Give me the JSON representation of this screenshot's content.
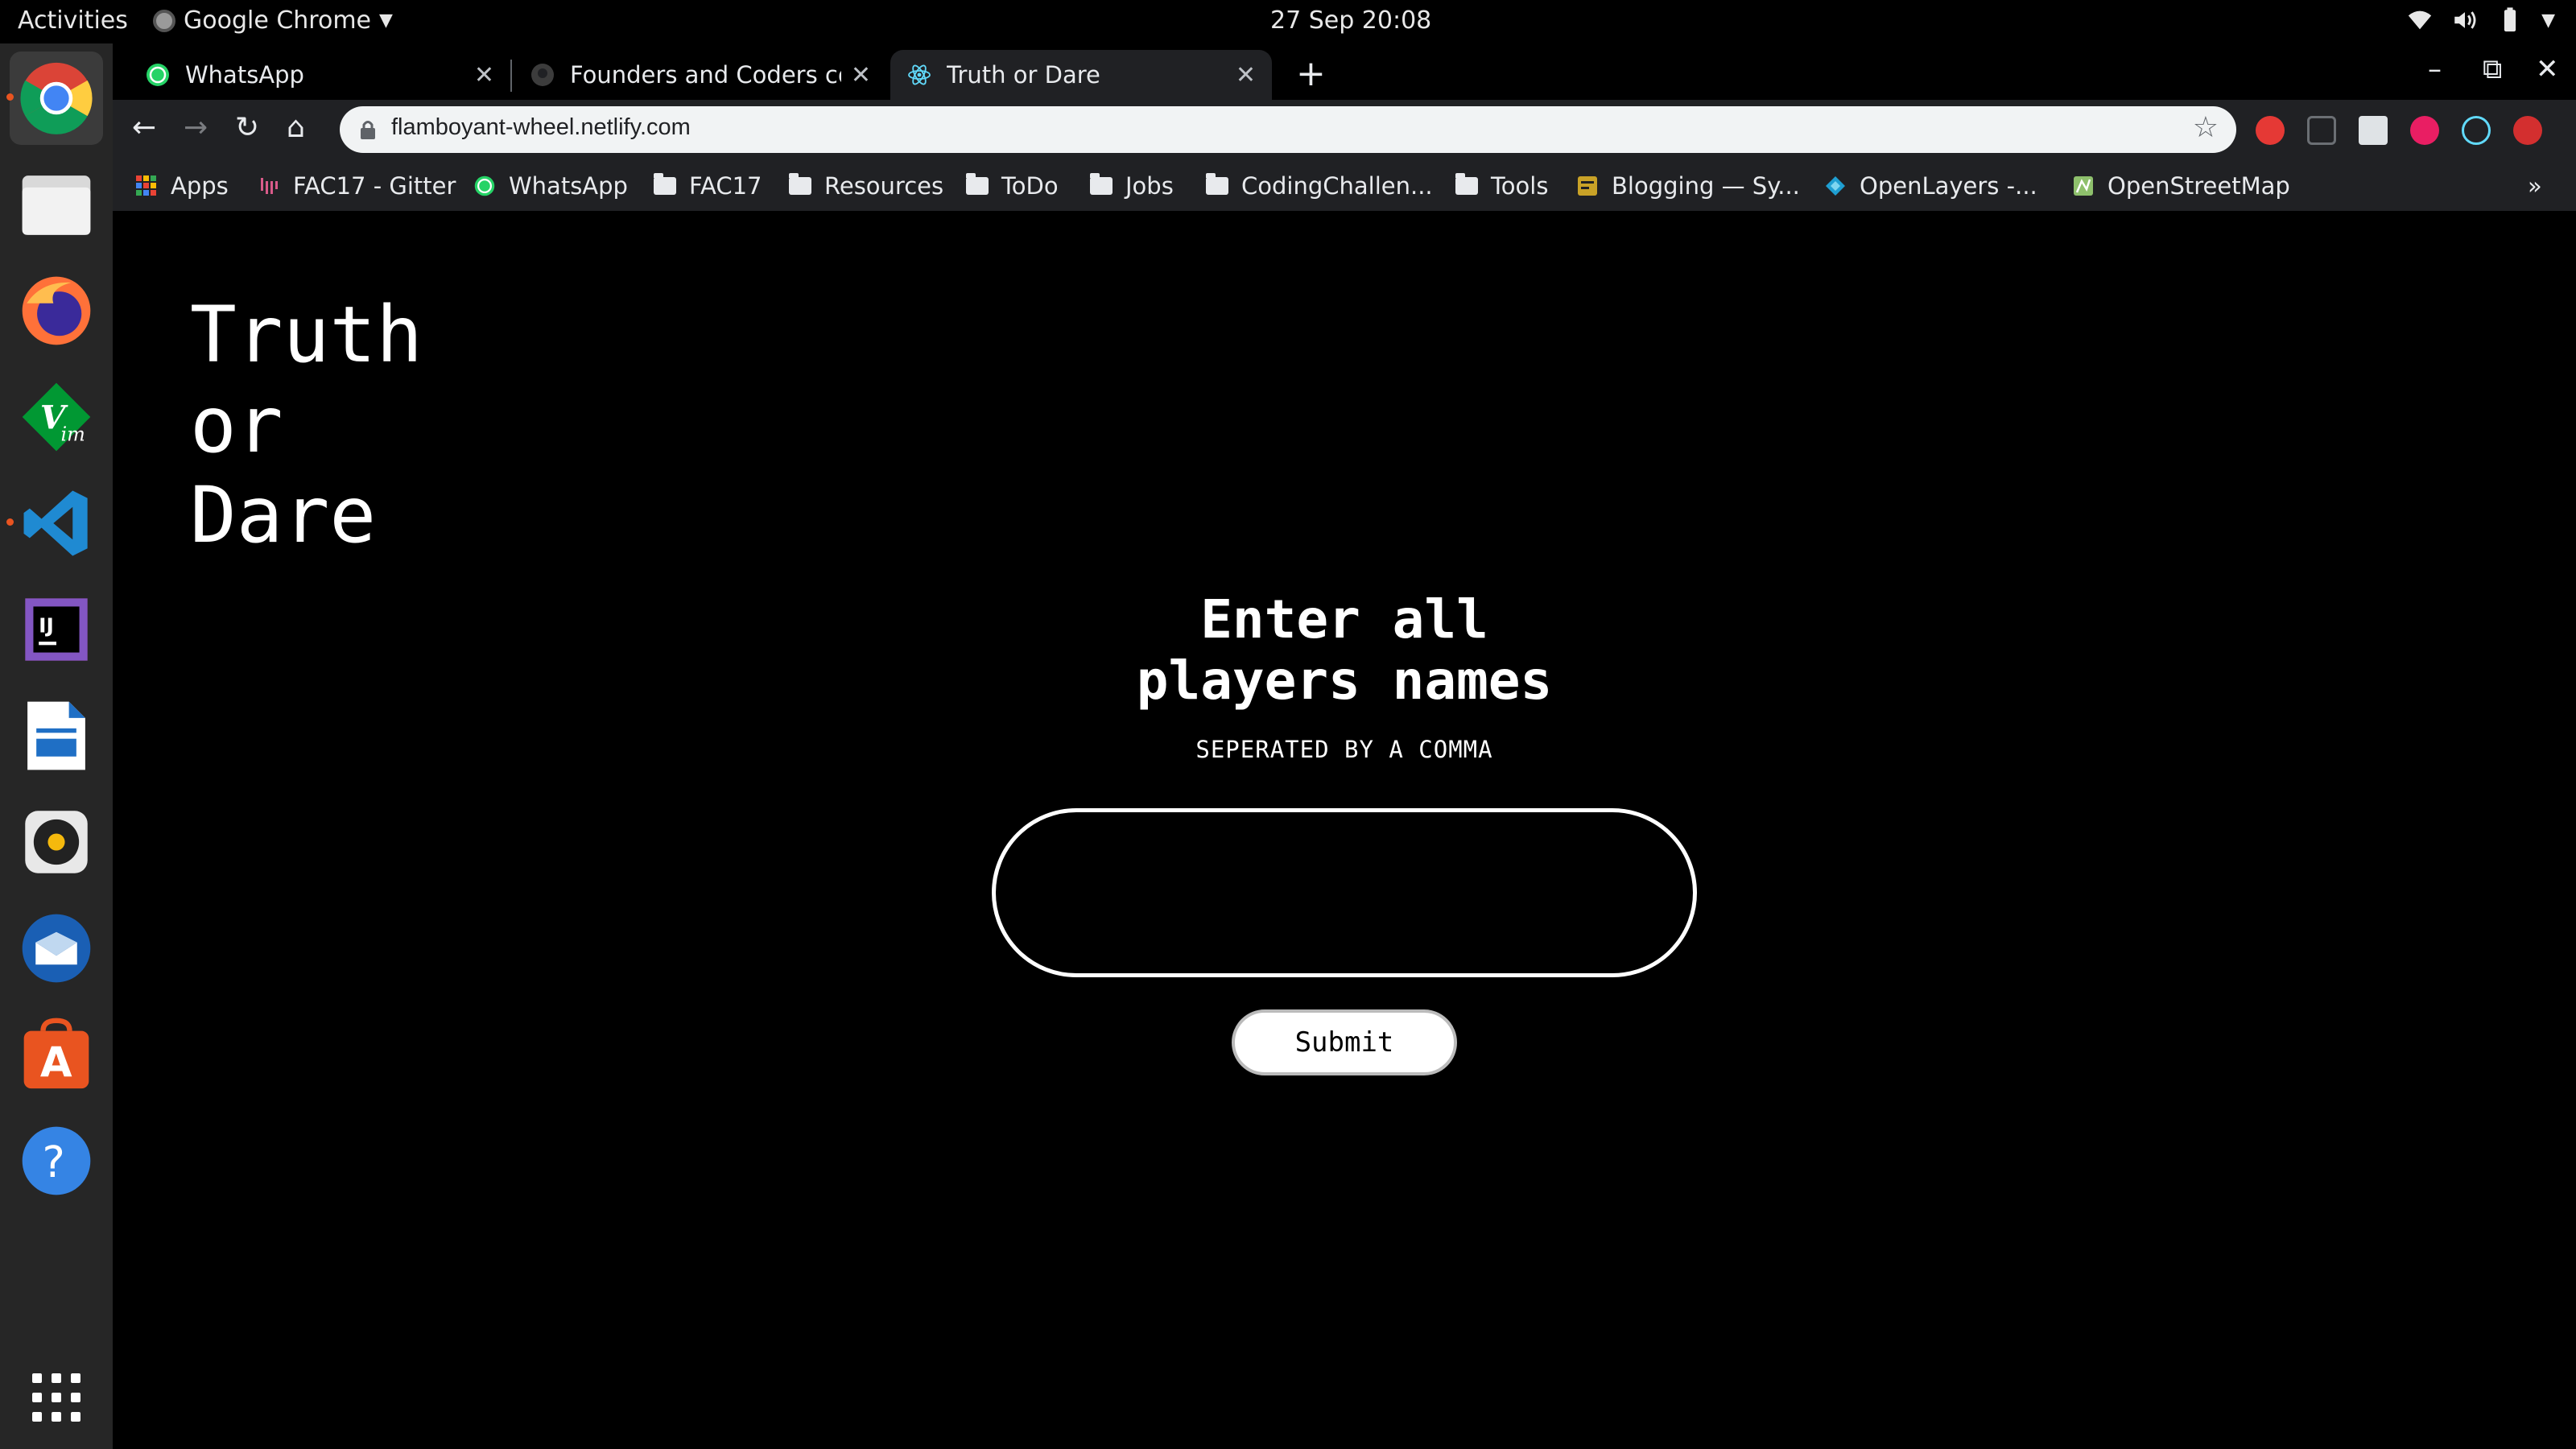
{
  "system_bar": {
    "activities": "Activities",
    "app_name": "Google Chrome",
    "clock": "27 Sep  20:08"
  },
  "dock": {
    "apps": [
      {
        "name": "chrome-icon"
      },
      {
        "name": "files-icon"
      },
      {
        "name": "firefox-icon"
      },
      {
        "name": "vim-icon"
      },
      {
        "name": "vscode-icon"
      },
      {
        "name": "intellij-icon"
      },
      {
        "name": "writer-icon"
      },
      {
        "name": "rhythmbox-icon"
      },
      {
        "name": "thunderbird-icon"
      },
      {
        "name": "software-center-icon"
      },
      {
        "name": "help-icon"
      }
    ]
  },
  "browser": {
    "tabs": [
      {
        "title": "WhatsApp"
      },
      {
        "title": "Founders and Coders coh"
      },
      {
        "title": "Truth or Dare"
      }
    ],
    "url": "flamboyant-wheel.netlify.com",
    "bookmarks": [
      "Apps",
      "FAC17 - Gitter",
      "WhatsApp",
      "FAC17",
      "Resources",
      "ToDo",
      "Jobs",
      "CodingChallen...",
      "Tools",
      "Blogging — Sy...",
      "OpenLayers -...",
      "OpenStreetMap"
    ],
    "overflow": "»"
  },
  "page": {
    "title_lines": [
      "Truth",
      "or",
      "Dare"
    ],
    "heading_line1": "Enter all",
    "heading_line2": "players names",
    "subheading": "SEPERATED BY A COMMA",
    "names_input_value": "",
    "submit_label": "Submit"
  },
  "colors": {
    "page_background": "#000000",
    "text": "#ffffff",
    "chrome_toolbar": "#202124",
    "omnibox": "#f1f3f4"
  }
}
